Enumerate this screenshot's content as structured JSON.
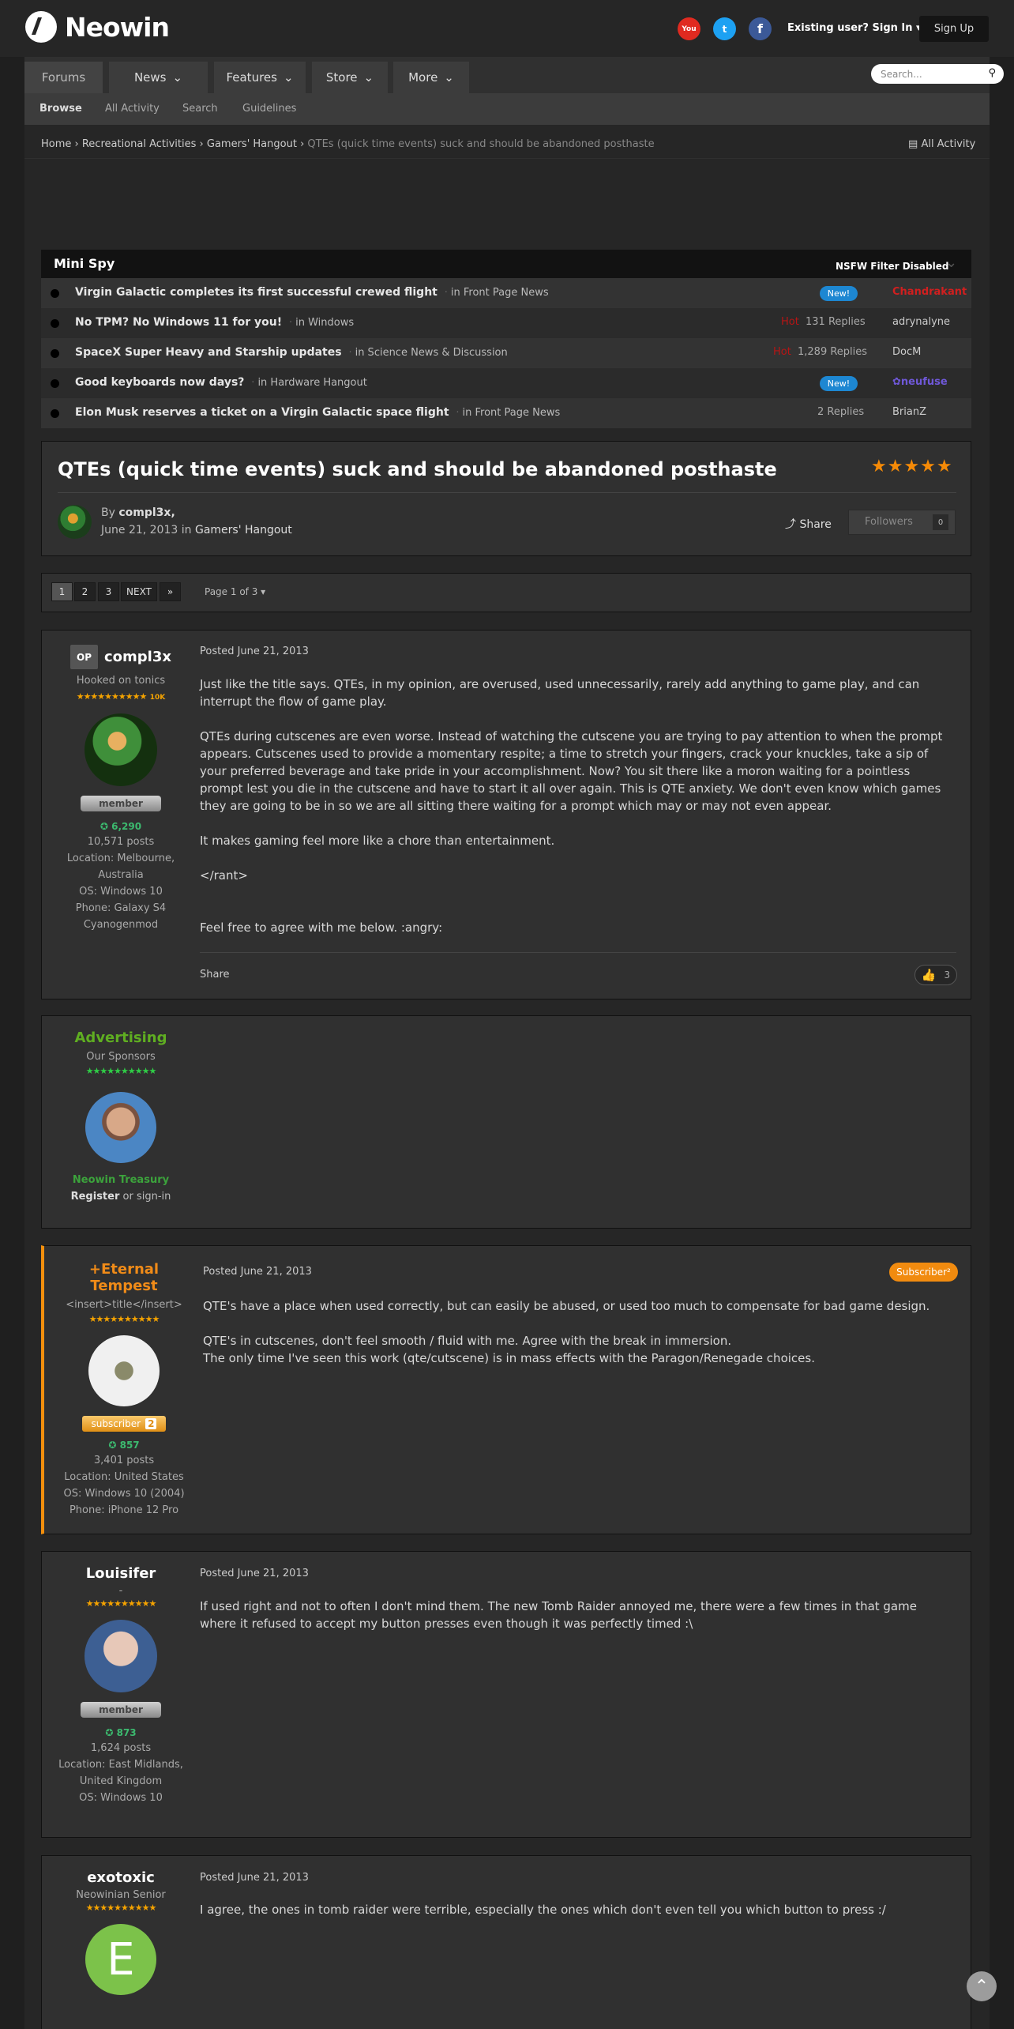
{
  "site": {
    "name": "Neowin"
  },
  "header": {
    "social": [
      "You",
      "t",
      "f"
    ],
    "signin": "Existing user? Sign In",
    "signup": "Sign Up"
  },
  "nav": {
    "tabs": [
      "Forums",
      "News",
      "Features",
      "Store",
      "More"
    ],
    "search_placeholder": "Search...",
    "subnav": [
      "Browse",
      "All Activity",
      "Search",
      "Guidelines"
    ]
  },
  "breadcrumb": {
    "items": [
      "Home",
      "Recreational Activities",
      "Gamers' Hangout"
    ],
    "current": "QTEs (quick time events) suck and should be abandoned posthaste",
    "all_activity": "All Activity"
  },
  "minispy": {
    "title": "Mini Spy",
    "filter": "NSFW Filter Disabled",
    "rows": [
      {
        "title": "Virgin Galactic completes its first successful crewed flight",
        "forum": "in Front Page News",
        "badge": "New!",
        "hot": "",
        "replies": "",
        "user": "Chandrakant",
        "user_color": "#d11f1f"
      },
      {
        "title": "No TPM? No Windows 11 for you!",
        "forum": "in Windows",
        "badge": "",
        "hot": "Hot",
        "replies": "131  Replies",
        "user": "adrynalyne",
        "user_color": "#cccccc"
      },
      {
        "title": "SpaceX Super Heavy and Starship updates",
        "forum": "in Science News & Discussion",
        "badge": "",
        "hot": "Hot",
        "replies": "1,289  Replies",
        "user": "DocM",
        "user_color": "#cccccc"
      },
      {
        "title": "Good keyboards now days?",
        "forum": "in Hardware Hangout",
        "badge": "New!",
        "hot": "",
        "replies": "",
        "user": "neufuse",
        "user_color": "#6f58d8"
      },
      {
        "title": "Elon Musk reserves a ticket on a Virgin Galactic space flight",
        "forum": "in Front Page News",
        "badge": "",
        "hot": "",
        "replies": "2  Replies",
        "user": "BrianZ",
        "user_color": "#cccccc"
      }
    ]
  },
  "topic": {
    "title": "QTEs (quick time events) suck and should be abandoned posthaste",
    "by_prefix": "By",
    "author": "compl3x,",
    "date": "June 21, 2013",
    "in_text": "in",
    "forum": "Gamers' Hangout",
    "share": "Share",
    "followers": "Followers",
    "followers_count": "0"
  },
  "pagination": {
    "pages": [
      "1",
      "2",
      "3"
    ],
    "next": "NEXT",
    "last": "»",
    "page_of": "Page 1 of 3"
  },
  "posts": [
    {
      "op": "OP",
      "author": "compl3x",
      "title": "Hooked on tonics",
      "stars": "★★★★★★★★★★",
      "stars_extra": "10K",
      "badge": "member",
      "rep": "6,290",
      "posts": "10,571 posts",
      "info": [
        "Location: Melbourne, Australia",
        "OS: Windows 10",
        "Phone: Galaxy S4 Cyanogenmod"
      ],
      "date": "Posted June 21, 2013",
      "body": [
        "Just like the title says. QTEs, in my opinion, are overused, used unnecessarily, rarely add anything to game play, and can interrupt the flow of game play.",
        "QTEs during cutscenes are even worse. Instead of watching the cutscene you are trying to pay attention to when the prompt appears. Cutscenes used to provide a momentary respite; a time to stretch your fingers, crack your knuckles, take a sip of your preferred beverage and take pride in your accomplishment. Now? You sit there like a moron waiting for a pointless prompt lest you die in the cutscene and have to start it all over again. This is QTE anxiety. We don't even know which games they are going to be in so we are all sitting there waiting for a prompt which may or may not even appear.",
        "It makes gaming feel more like a chore than entertainment.",
        "</rant>",
        "Feel free to agree with me below.  :angry:"
      ],
      "share": "Share",
      "likes": "3"
    },
    {
      "author": "Advertising",
      "title": "Our Sponsors",
      "stars": "★★★★★★★★★★",
      "name2": "Neowin Treasury",
      "register": "Register",
      "or": "or sign-in"
    },
    {
      "author": "+Eternal Tempest",
      "title": "<insert>title</insert>",
      "stars": "★★★★★★★★★★",
      "badge": "subscriber",
      "badge_num": "2",
      "rep": "857",
      "posts": "3,401 posts",
      "info": [
        "Location: United States",
        "OS: Windows 10 (2004)",
        "Phone: iPhone 12 Pro"
      ],
      "date": "Posted June 21, 2013",
      "sub_badge": "Subscriber²",
      "body": [
        "QTE's have a place when used correctly, but can easily be abused, or used too much to compensate for bad game design.",
        "QTE's in cutscenes, don't feel smooth / fluid with me. Agree with the break in immersion.",
        "The only time I've seen this work (qte/cutscene) is in mass effects with the Paragon/Renegade choices."
      ]
    },
    {
      "author": "Louisifer",
      "title": "-",
      "stars": "★★★★★★★★★★",
      "badge": "member",
      "rep": "873",
      "posts": "1,624 posts",
      "info": [
        "Location: East Midlands, United Kingdom",
        "OS: Windows 10"
      ],
      "date": "Posted June 21, 2013",
      "body": [
        "If used right and not to often I don't mind them. The new Tomb Raider annoyed me, there were a few times in that game where it refused to accept my button presses even though it was perfectly timed :\\"
      ]
    },
    {
      "author": "exotoxic",
      "title": "Neowinian Senior",
      "stars": "★★★★★★★★★★",
      "avatar_letter": "E",
      "date": "Posted June 21, 2013",
      "body": [
        "I agree, the ones in tomb raider were terrible,  especially the ones which don't even tell you which button to press :/"
      ]
    }
  ],
  "scroll_top": "⌃"
}
